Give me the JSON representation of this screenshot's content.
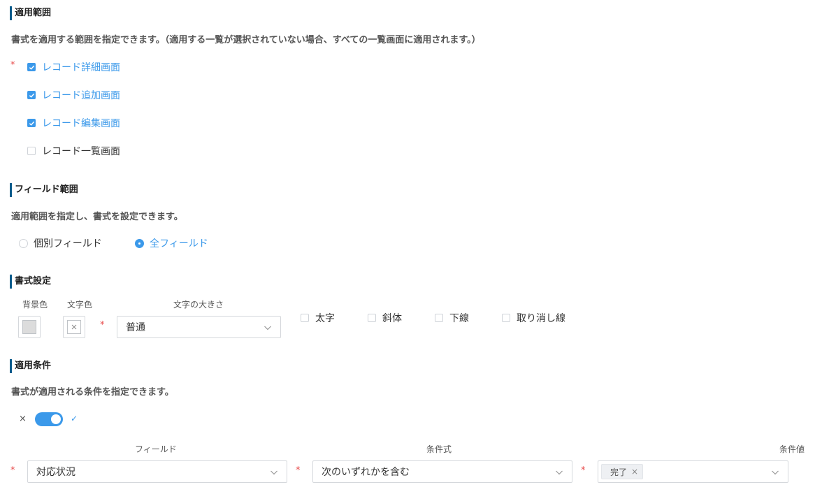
{
  "apply_scope": {
    "title": "適用範囲",
    "description": "書式を適用する範囲を指定できます。（適用する一覧が選択されていない場合、すべての一覧画面に適用されます。）",
    "required_mark": "*",
    "options": [
      {
        "label": "レコード詳細画面",
        "checked": true
      },
      {
        "label": "レコード追加画面",
        "checked": true
      },
      {
        "label": "レコード編集画面",
        "checked": true
      },
      {
        "label": "レコード一覧画面",
        "checked": false
      }
    ]
  },
  "field_scope": {
    "title": "フィールド範囲",
    "description": "適用範囲を指定し、書式を設定できます。",
    "options": [
      {
        "label": "個別フィールド",
        "selected": false
      },
      {
        "label": "全フィールド",
        "selected": true
      }
    ]
  },
  "format": {
    "title": "書式設定",
    "background_label": "背景色",
    "text_color_label": "文字色",
    "font_size_label": "文字の大きさ",
    "required_mark": "*",
    "font_size_value": "普通",
    "styles": [
      {
        "label": "太字",
        "checked": false
      },
      {
        "label": "斜体",
        "checked": false
      },
      {
        "label": "下線",
        "checked": false
      },
      {
        "label": "取り消し線",
        "checked": false
      }
    ]
  },
  "condition": {
    "title": "適用条件",
    "description": "書式が適用される条件を指定できます。",
    "toggle_off_icon": "×",
    "toggle_on_icon": "✓",
    "toggle_on": true,
    "required_mark": "*",
    "field_label": "フィールド",
    "expr_label": "条件式",
    "value_label": "条件値",
    "field_value": "対応状況",
    "expr_value": "次のいずれかを含む",
    "value_tags": [
      "完了"
    ],
    "tag_remove_icon": "×"
  },
  "colors": {
    "accent": "#3b99ea",
    "required": "#e84a4a",
    "title_bar": "#0b5c8c"
  }
}
